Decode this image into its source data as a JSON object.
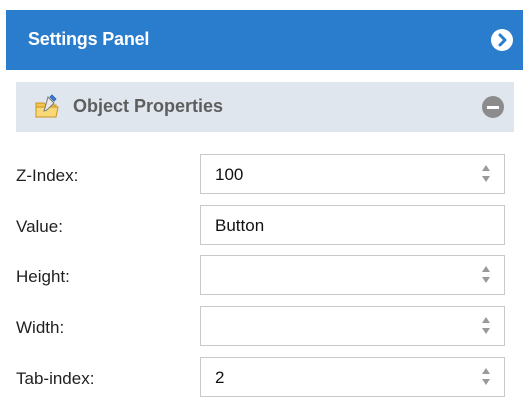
{
  "header": {
    "title": "Settings Panel",
    "color": "#2a7ccd",
    "action_icon": "chevron-right-circle-icon"
  },
  "section": {
    "title": "Object Properties",
    "icon": "edit-folder-icon",
    "action_icon": "minus-circle-icon",
    "background": "#dfe6ee"
  },
  "fields": [
    {
      "label": "Z-Index:",
      "value": "100",
      "type": "number"
    },
    {
      "label": "Value:",
      "value": "Button",
      "type": "text"
    },
    {
      "label": "Height:",
      "value": "",
      "type": "number"
    },
    {
      "label": "Width:",
      "value": "",
      "type": "number"
    },
    {
      "label": "Tab-index:",
      "value": "2",
      "type": "number"
    }
  ]
}
